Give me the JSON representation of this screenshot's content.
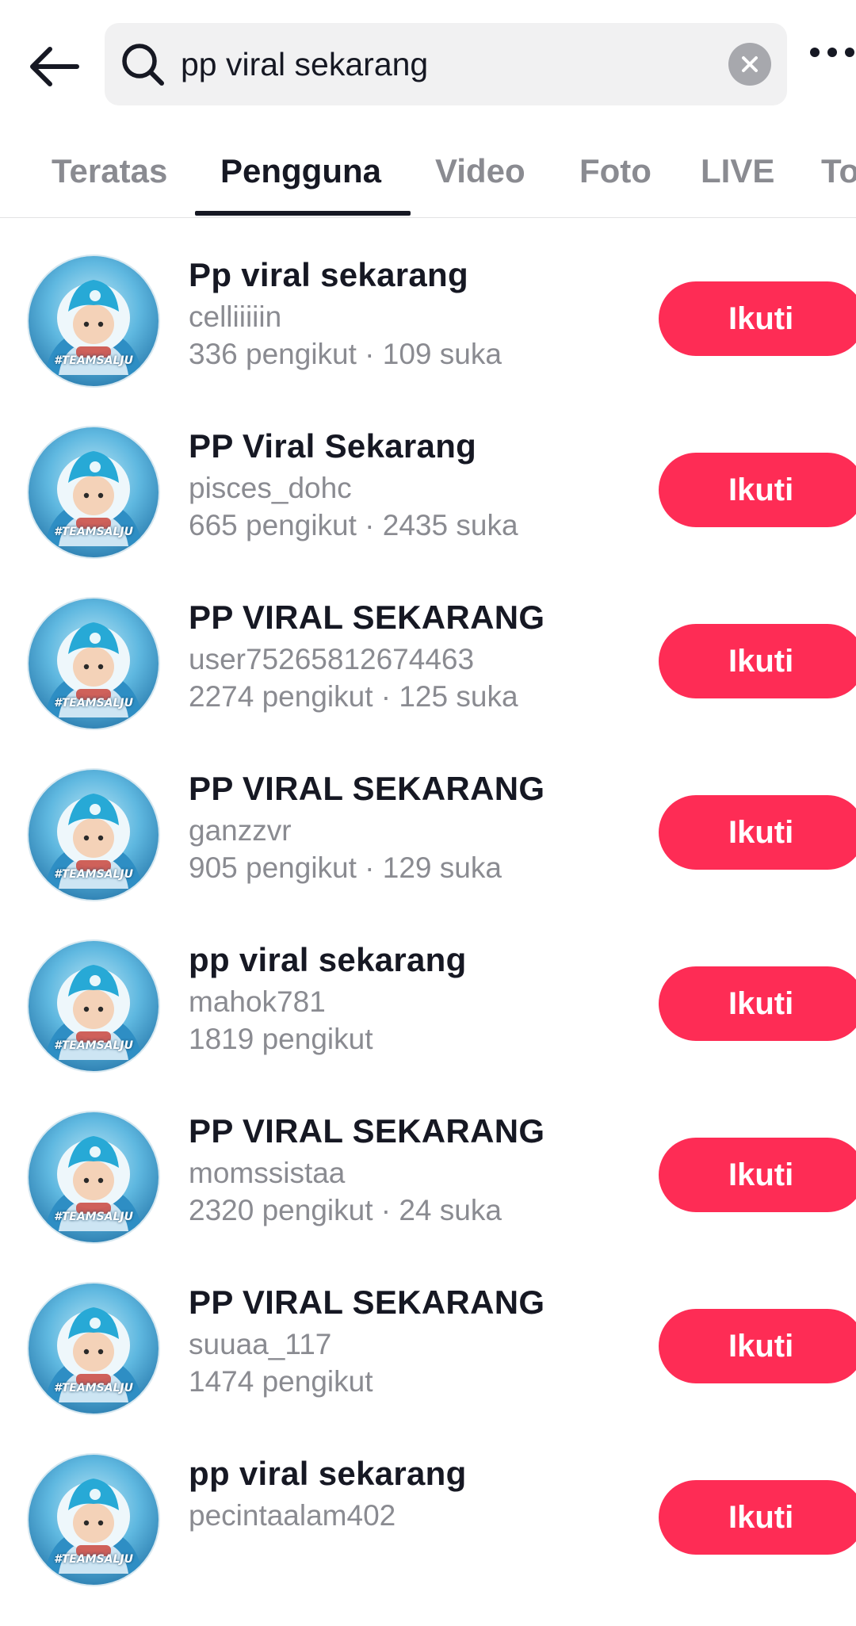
{
  "search": {
    "query": "pp viral sekarang"
  },
  "tabs": [
    {
      "label": "Teratas"
    },
    {
      "label": "Pengguna"
    },
    {
      "label": "Video"
    },
    {
      "label": "Foto"
    },
    {
      "label": "LIVE"
    },
    {
      "label": "To"
    }
  ],
  "active_tab": "Pengguna",
  "users": [
    {
      "name": "Pp viral sekarang",
      "handle": "celliiiiin",
      "stats": "336 pengikut · 109 suka",
      "follow_label": "Ikuti",
      "avatar_text": "#TEAMSALJU"
    },
    {
      "name": "PP Viral Sekarang",
      "handle": "pisces_dohc",
      "stats": "665 pengikut · 2435 suka",
      "follow_label": "Ikuti",
      "avatar_text": "#TEAMSALJU"
    },
    {
      "name": "PP VIRAL SEKARANG",
      "handle": "user75265812674463",
      "stats": "2274 pengikut · 125 suka",
      "follow_label": "Ikuti",
      "avatar_text": "#TEAMSALJU"
    },
    {
      "name": "PP VIRAL SEKARANG",
      "handle": "ganzzvr",
      "stats": "905 pengikut · 129 suka",
      "follow_label": "Ikuti",
      "avatar_text": "#TEAMSALJU"
    },
    {
      "name": "pp viral sekarang",
      "handle": "mahok781",
      "stats": "1819 pengikut",
      "follow_label": "Ikuti",
      "avatar_text": "#TEAMSALJU"
    },
    {
      "name": "PP VIRAL SEKARANG",
      "handle": "momssistaa",
      "stats": "2320 pengikut · 24 suka",
      "follow_label": "Ikuti",
      "avatar_text": "#TEAMSALJU"
    },
    {
      "name": "PP VIRAL SEKARANG",
      "handle": "suuaa_117",
      "stats": "1474 pengikut",
      "follow_label": "Ikuti",
      "avatar_text": "#TEAMSALJU"
    },
    {
      "name": "pp viral sekarang",
      "handle": "pecintaalam402",
      "stats": "",
      "follow_label": "Ikuti",
      "avatar_text": "#TEAMSALJU"
    }
  ],
  "colors": {
    "accent": "#fe2c55",
    "text_primary": "#161823",
    "text_secondary": "#8a8b91",
    "search_bg": "#f1f1f2"
  },
  "icons": {
    "back": "arrow-left-icon",
    "search": "search-icon",
    "clear": "clear-icon",
    "more": "more-icon"
  }
}
